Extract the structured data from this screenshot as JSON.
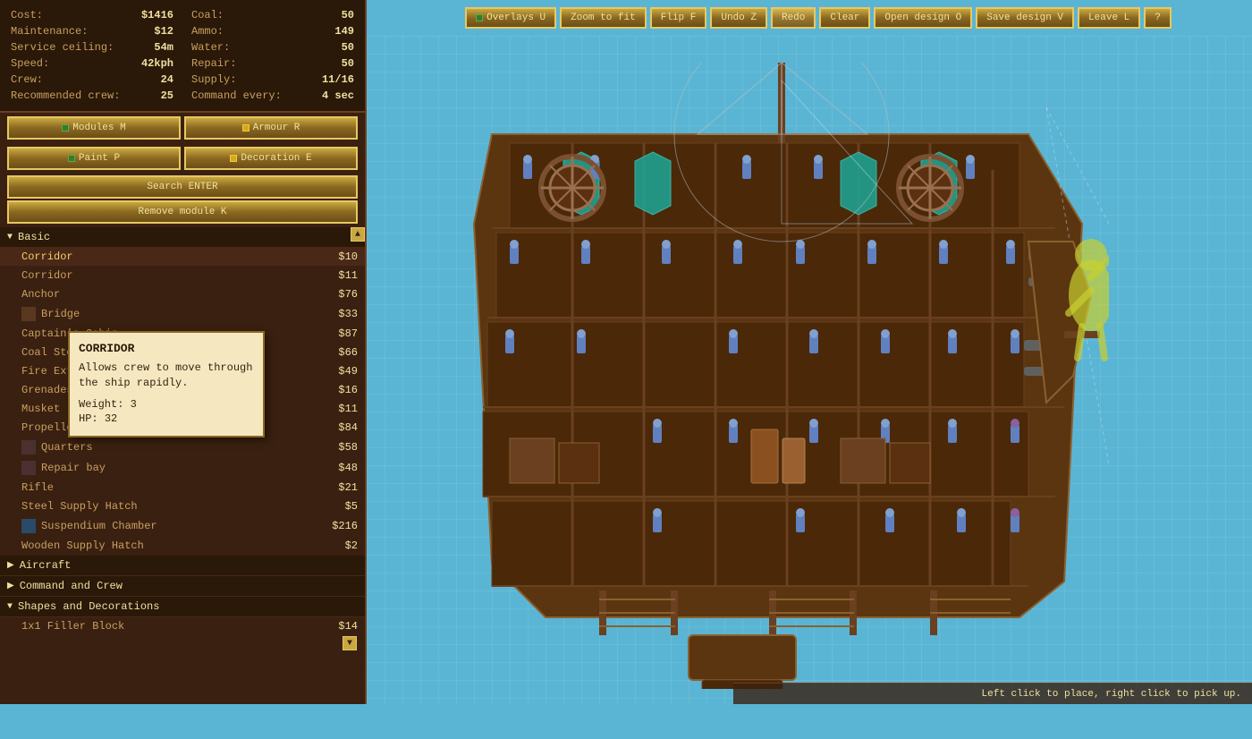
{
  "toolbar": {
    "buttons": [
      {
        "label": "Overlays U",
        "key": "U",
        "has_indicator": true,
        "id": "overlays"
      },
      {
        "label": "Zoom to fit",
        "key": "",
        "has_indicator": false,
        "id": "zoom-to-fit"
      },
      {
        "label": "Flip F",
        "key": "F",
        "has_indicator": false,
        "id": "flip"
      },
      {
        "label": "Undo Z",
        "key": "Z",
        "has_indicator": false,
        "id": "undo"
      },
      {
        "label": "Redo",
        "key": "",
        "has_indicator": false,
        "id": "redo"
      },
      {
        "label": "Clear",
        "key": "",
        "has_indicator": false,
        "id": "clear"
      },
      {
        "label": "Open design O",
        "key": "O",
        "has_indicator": false,
        "id": "open"
      },
      {
        "label": "Save design V",
        "key": "V",
        "has_indicator": false,
        "id": "save"
      },
      {
        "label": "Leave L",
        "key": "L",
        "has_indicator": false,
        "id": "leave"
      },
      {
        "label": "?",
        "key": "",
        "has_indicator": false,
        "id": "help"
      }
    ]
  },
  "stats": {
    "left": [
      {
        "label": "Cost:",
        "value": "$1416"
      },
      {
        "label": "Maintenance:",
        "value": "$12"
      },
      {
        "label": "Service ceiling:",
        "value": "54m"
      },
      {
        "label": "Speed:",
        "value": "42kph"
      },
      {
        "label": "Crew:",
        "value": "24"
      },
      {
        "label": "Recommended crew:",
        "value": "25"
      }
    ],
    "right": [
      {
        "label": "Coal:",
        "value": "50"
      },
      {
        "label": "Ammo:",
        "value": "149"
      },
      {
        "label": "Water:",
        "value": "50"
      },
      {
        "label": "Repair:",
        "value": "50"
      },
      {
        "label": "Supply:",
        "value": "11/16"
      },
      {
        "label": "Command every:",
        "value": "4 sec"
      }
    ]
  },
  "panel_buttons": {
    "row1": [
      {
        "label": "Modules M",
        "indicator": "green"
      },
      {
        "label": "Armour R",
        "indicator": "yellow"
      }
    ],
    "row2": [
      {
        "label": "Paint P",
        "indicator": "green"
      },
      {
        "label": "Decoration E",
        "indicator": "yellow"
      }
    ]
  },
  "search_label": "Search ENTER",
  "remove_label": "Remove module K",
  "categories": [
    {
      "name": "Basic",
      "expanded": true,
      "items": [
        {
          "name": "Corridor",
          "price": "$10",
          "selected": true,
          "has_icon": false
        },
        {
          "name": "Corridor",
          "price": "$11",
          "selected": false,
          "has_icon": false
        },
        {
          "name": "Anchor",
          "price": "$76",
          "selected": false,
          "has_icon": false
        },
        {
          "name": "Bridge",
          "price": "$33",
          "selected": false,
          "has_icon": true
        },
        {
          "name": "Captain's Cabin",
          "price": "$87",
          "selected": false,
          "has_icon": false
        },
        {
          "name": "Coal Store",
          "price": "$66",
          "selected": false,
          "has_icon": false
        },
        {
          "name": "Fire Extinguisher",
          "price": "$49",
          "selected": false,
          "has_icon": false
        },
        {
          "name": "Grenades",
          "price": "$16",
          "selected": false,
          "has_icon": false
        },
        {
          "name": "Musket",
          "price": "$11",
          "selected": false,
          "has_icon": false
        },
        {
          "name": "Propeller",
          "price": "$84",
          "selected": false,
          "has_icon": false
        },
        {
          "name": "Quarters",
          "price": "$58",
          "selected": false,
          "has_icon": true
        },
        {
          "name": "Repair bay",
          "price": "$48",
          "selected": false,
          "has_icon": true
        },
        {
          "name": "Rifle",
          "price": "$21",
          "selected": false,
          "has_icon": false
        },
        {
          "name": "Steel Supply Hatch",
          "price": "$5",
          "selected": false,
          "has_icon": false
        },
        {
          "name": "Suspendium Chamber",
          "price": "$216",
          "selected": false,
          "has_icon": true
        },
        {
          "name": "Wooden Supply Hatch",
          "price": "$2",
          "selected": false,
          "has_icon": false
        }
      ]
    },
    {
      "name": "Aircraft",
      "expanded": false,
      "items": []
    },
    {
      "name": "Command and Crew",
      "expanded": false,
      "items": []
    },
    {
      "name": "Shapes and Decorations",
      "expanded": true,
      "items": [
        {
          "name": "1x1 Filler Block",
          "price": "$14",
          "selected": false,
          "has_icon": false
        }
      ]
    }
  ],
  "tooltip": {
    "title": "CORRIDOR",
    "description": "Allows crew to move through the ship rapidly.",
    "weight": "3",
    "hp": "32"
  },
  "status_bar": {
    "text": "Left click to place, right click to pick up."
  }
}
